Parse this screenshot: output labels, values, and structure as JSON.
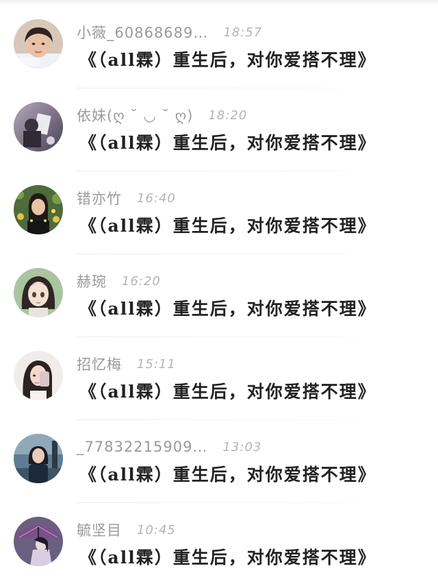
{
  "comments": [
    {
      "username": "小薇_60868689…",
      "time": "18:57",
      "message": "《（all霖）重生后，对你爱搭不理》",
      "avatar_icon": "girl-selfie-avatar"
    },
    {
      "username": "依妹(ღ ˘ ◡ ˘ ღ)",
      "time": "18:20",
      "message": "《（all霖）重生后，对你爱搭不理》",
      "avatar_icon": "dark-photo-avatar"
    },
    {
      "username": "错亦竹",
      "time": "16:40",
      "message": "《（all霖）重生后，对你爱搭不理》",
      "avatar_icon": "girl-flowers-avatar"
    },
    {
      "username": "赫琬",
      "time": "16:20",
      "message": "《（all霖）重生后，对你爱搭不理》",
      "avatar_icon": "anime-girl-avatar"
    },
    {
      "username": "招忆梅",
      "time": "15:11",
      "message": "《（all霖）重生后，对你爱搭不理》",
      "avatar_icon": "girl-phone-avatar"
    },
    {
      "username": "_77832215909…",
      "time": "13:03",
      "message": "《（all霖）重生后，对你爱搭不理》",
      "avatar_icon": "girl-street-avatar"
    },
    {
      "username": "毓坚目",
      "time": "10:45",
      "message": "《（all霖）重生后，对你爱搭不理》",
      "avatar_icon": "umbrella-art-avatar"
    }
  ]
}
